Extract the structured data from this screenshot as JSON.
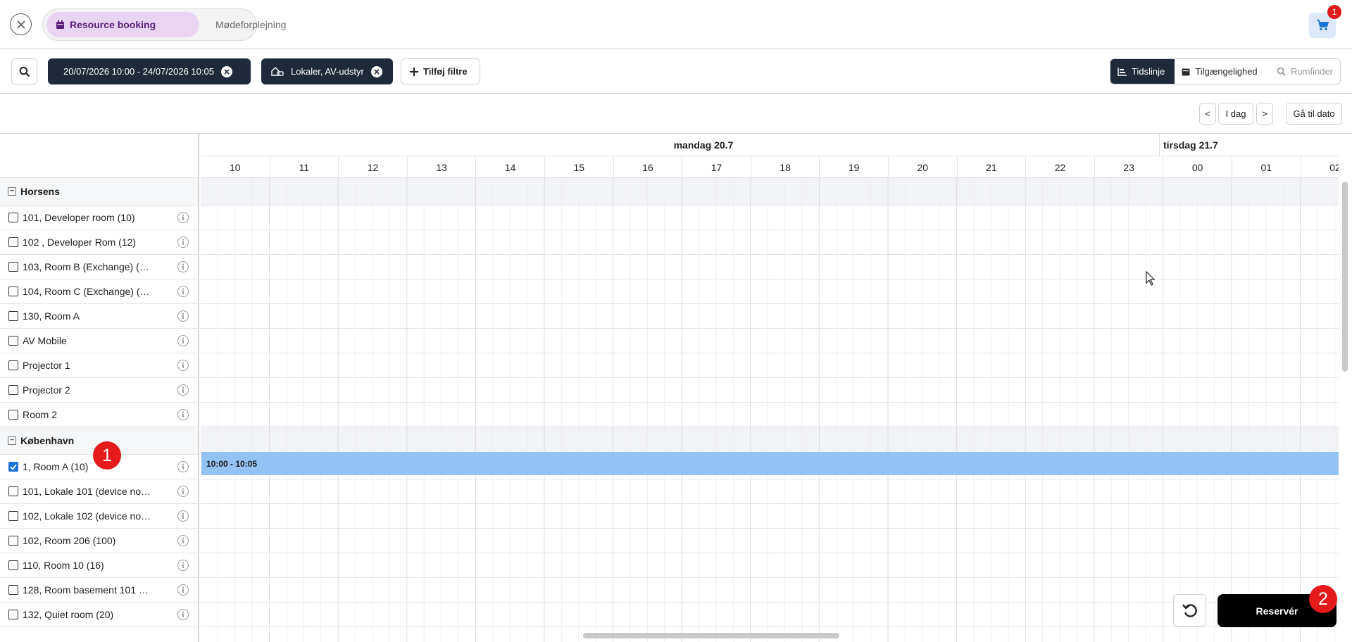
{
  "colors": {
    "primary_dark": "#1e2a3b",
    "booking_bar": "#93c3f5",
    "active_mode_bg": "#e9d4f3",
    "badge_red": "#e01b1b",
    "checkbox_checked": "#1a73d9"
  },
  "topbar": {
    "modes": [
      {
        "label": "Resource booking",
        "icon": "calendar-icon",
        "active": true
      },
      {
        "label": "Mødeforplejning",
        "active": false
      }
    ],
    "cart_badge": "1"
  },
  "filters": {
    "chips": [
      {
        "label": "20/07/2026 10:00 - 24/07/2026 10:05"
      },
      {
        "label": "Lokaler, AV-udstyr",
        "icon": "room-equipment-icon"
      }
    ],
    "add_filter_label": "Tilføj filtre"
  },
  "view_tabs": [
    {
      "label": "Tidslinje",
      "icon": "timeline-icon",
      "state": "active"
    },
    {
      "label": "Tilgængelighed",
      "icon": "calendar-icon",
      "state": "normal"
    },
    {
      "label": "Rumfinder",
      "icon": "search-icon",
      "state": "disabled"
    }
  ],
  "date_nav": {
    "prev": "<",
    "today": "I dag",
    "next": ">",
    "goto": "Gå til dato"
  },
  "timeline": {
    "days": [
      "mandag 20.7",
      "tirsdag 21.7"
    ],
    "hours": [
      "10",
      "11",
      "12",
      "13",
      "14",
      "15",
      "16",
      "17",
      "18",
      "19",
      "20",
      "21",
      "22",
      "23",
      "00",
      "01",
      "02"
    ],
    "booking_label": "10:00 - 10:05"
  },
  "groups": [
    {
      "name": "Horsens",
      "resources": [
        {
          "label": "101, Developer room (10)",
          "checked": false
        },
        {
          "label": "102 , Developer Rom (12)",
          "checked": false
        },
        {
          "label": "103, Room B (Exchange) (…",
          "checked": false
        },
        {
          "label": "104, Room C (Exchange) (…",
          "checked": false
        },
        {
          "label": "130, Room A",
          "checked": false
        },
        {
          "label": "AV Mobile",
          "checked": false
        },
        {
          "label": "Projector 1",
          "checked": false
        },
        {
          "label": "Projector 2",
          "checked": false
        },
        {
          "label": "Room 2",
          "checked": false
        }
      ]
    },
    {
      "name": "København",
      "resources": [
        {
          "label": "1, Room A (10)",
          "checked": true
        },
        {
          "label": "101, Lokale 101 (device no…",
          "checked": false
        },
        {
          "label": "102, Lokale 102 (device no…",
          "checked": false
        },
        {
          "label": "102, Room 206 (100)",
          "checked": false
        },
        {
          "label": "110, Room 10 (16)",
          "checked": false
        },
        {
          "label": "128, Room basement 101 …",
          "checked": false
        },
        {
          "label": "132, Quiet room (20)",
          "checked": false
        }
      ]
    }
  ],
  "actions": {
    "reserve_label": "Reservér"
  },
  "markers": [
    "1",
    "2"
  ]
}
